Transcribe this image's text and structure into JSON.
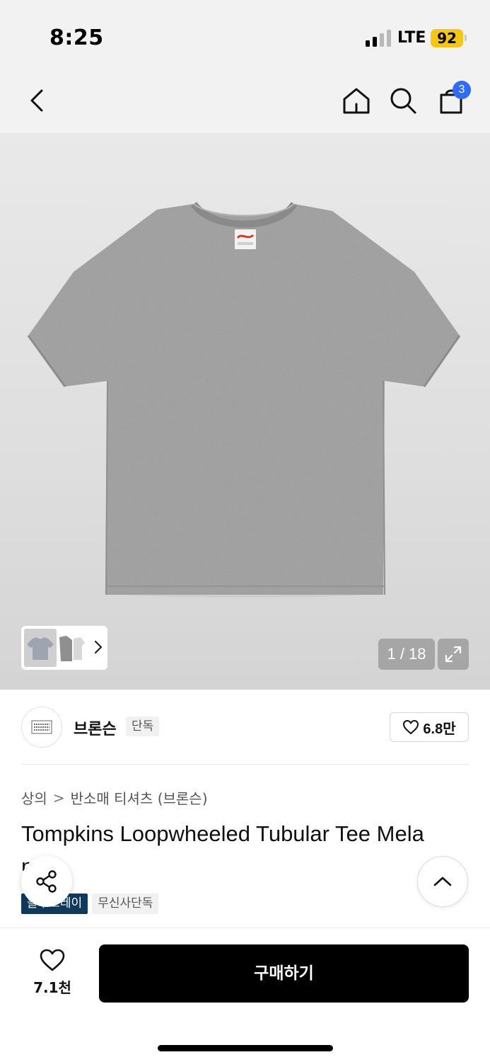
{
  "status_bar": {
    "time": "8:25",
    "network": "LTE",
    "battery": "92",
    "colors": {
      "battery": "#f5c518"
    }
  },
  "nav": {
    "icons": [
      "back-chevron-icon",
      "home-icon",
      "search-icon",
      "shopping-bag-icon"
    ],
    "cart_count": "3",
    "colors": {
      "badge": "#2f6bf6"
    }
  },
  "gallery": {
    "counter": "1 / 18",
    "current_page": 1,
    "total_pages": 18,
    "icons": [
      "thumbnail-next-icon",
      "expand-icon"
    ]
  },
  "brand": {
    "name": "브론슨",
    "tag": "단독",
    "likes": "6.8만",
    "icons": [
      "brand-logo",
      "heart-outline-icon"
    ]
  },
  "breadcrumb": {
    "category": "상의",
    "separator": ">",
    "subcategory": "반소매 티셔츠 (브론슨)"
  },
  "product": {
    "title": "Tompkins Loopwheeled Tubular Tee Mela",
    "title_overflow": "n",
    "tags": [
      "블루프레이",
      "무신사단독"
    ],
    "colors": {
      "tag_dark": "#0f3a5c"
    }
  },
  "fabs": {
    "icons": [
      "share-icon",
      "chevron-up-icon"
    ]
  },
  "bottom_bar": {
    "wish_count": "7.1천",
    "buy_label": "구매하기",
    "icons": [
      "heart-outline-icon"
    ],
    "colors": {
      "buy_button": "#000000"
    }
  }
}
